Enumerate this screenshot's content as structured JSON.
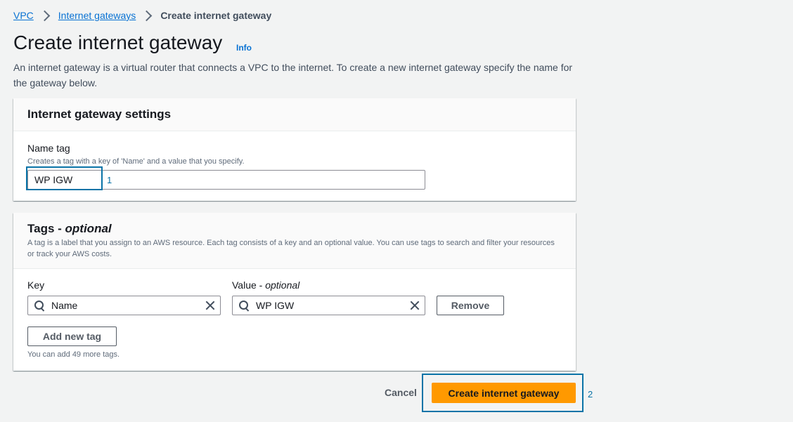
{
  "breadcrumb": {
    "items": [
      "VPC",
      "Internet gateways"
    ],
    "current": "Create internet gateway"
  },
  "header": {
    "title": "Create internet gateway",
    "info_link": "Info",
    "description": "An internet gateway is a virtual router that connects a VPC to the internet. To create a new internet gateway specify the name for the gateway below."
  },
  "settings": {
    "heading": "Internet gateway settings",
    "name_tag_label": "Name tag",
    "name_tag_hint": "Creates a tag with a key of 'Name' and a value that you specify.",
    "name_tag_value": "WP IGW"
  },
  "tags": {
    "heading_prefix": "Tags - ",
    "heading_suffix": "optional",
    "description": "A tag is a label that you assign to an AWS resource. Each tag consists of a key and an optional value. You can use tags to search and filter your resources or track your AWS costs.",
    "key_label": "Key",
    "value_label_prefix": "Value - ",
    "value_label_suffix": "optional",
    "rows": [
      {
        "key": "Name",
        "value": "WP IGW",
        "remove_label": "Remove"
      }
    ],
    "add_button": "Add new tag",
    "remaining_hint": "You can add 49 more tags."
  },
  "footer": {
    "cancel_label": "Cancel",
    "submit_label": "Create internet gateway"
  },
  "annotations": {
    "marker_1": "1",
    "marker_2": "2"
  },
  "colors": {
    "primary": "#ff9900",
    "link": "#0972d3",
    "highlight": "#0a73a7"
  }
}
